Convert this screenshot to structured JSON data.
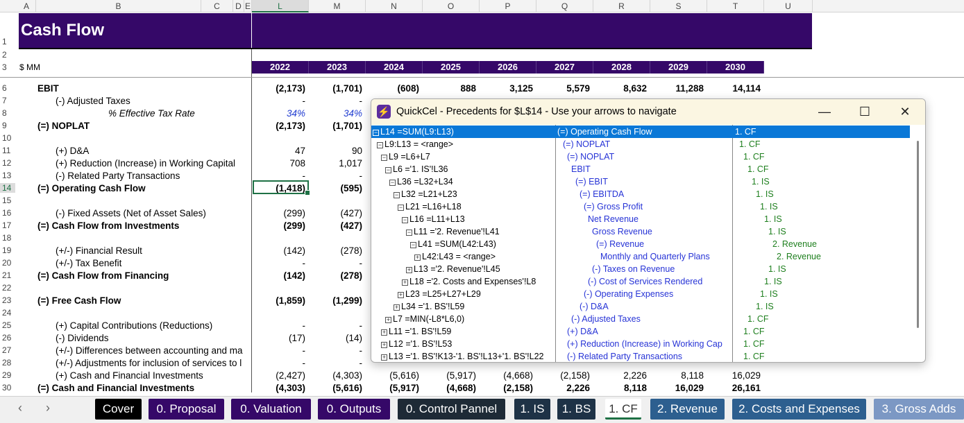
{
  "columns": [
    "A",
    "B",
    "C",
    "D",
    "E",
    "L",
    "M",
    "N",
    "O",
    "P",
    "Q",
    "R",
    "S",
    "T",
    "U"
  ],
  "row_numbers": [
    "1",
    "2",
    "3",
    "6",
    "7",
    "8",
    "9",
    "10",
    "11",
    "12",
    "13",
    "14",
    "15",
    "16",
    "17",
    "18",
    "19",
    "20",
    "21",
    "22",
    "23",
    "24",
    "25",
    "26",
    "27",
    "28",
    "29",
    "30"
  ],
  "sheet": {
    "title": "Cash Flow",
    "units": "$ MM",
    "years": [
      "2022",
      "2023",
      "2024",
      "2025",
      "2026",
      "2027",
      "2028",
      "2029",
      "2030"
    ],
    "rows": [
      {
        "label": "EBIT",
        "values": [
          "(2,173)",
          "(1,701)",
          "(608)",
          "888",
          "3,125",
          "5,579",
          "8,632",
          "11,288",
          "14,114"
        ]
      },
      {
        "label": "(-) Adjusted Taxes",
        "values": [
          "-",
          "-"
        ]
      },
      {
        "label": "% Effective Tax Rate",
        "values": [
          "34%",
          "34%"
        ]
      },
      {
        "label": "(=) NOPLAT",
        "values": [
          "(2,173)",
          "(1,701)"
        ]
      },
      {
        "label": "(+) D&A",
        "values": [
          "47",
          "90"
        ]
      },
      {
        "label": "(+) Reduction (Increase) in Working Capital",
        "values": [
          "708",
          "1,017"
        ]
      },
      {
        "label": "(-) Related Party Transactions",
        "values": [
          "-",
          "-"
        ]
      },
      {
        "label": "(=) Operating Cash Flow",
        "values": [
          "(1,418)",
          "(595)"
        ]
      },
      {
        "label": "(-) Fixed Assets (Net of Asset Sales)",
        "values": [
          "(299)",
          "(427)"
        ]
      },
      {
        "label": "(=) Cash Flow from Investments",
        "values": [
          "(299)",
          "(427)"
        ]
      },
      {
        "label": "(+/-) Financial Result",
        "values": [
          "(142)",
          "(278)"
        ]
      },
      {
        "label": "(+/-) Tax Benefit",
        "values": [
          "-",
          "-"
        ]
      },
      {
        "label": "(=) Cash Flow from Financing",
        "values": [
          "(142)",
          "(278)"
        ]
      },
      {
        "label": "(=) Free Cash Flow",
        "values": [
          "(1,859)",
          "(1,299)"
        ]
      },
      {
        "label": "(+) Capital Contributions (Reductions)",
        "values": [
          "-",
          "-"
        ]
      },
      {
        "label": "(-) Dividends",
        "values": [
          "(17)",
          "(14)"
        ]
      },
      {
        "label": "(+/-) Differences between accounting and ma",
        "values": [
          "-",
          "-"
        ]
      },
      {
        "label": "(+/-) Adjustments for inclusion of services to l",
        "values": [
          "-",
          "-"
        ]
      },
      {
        "label": "(+) Cash and Financial Investments",
        "values": [
          "(2,427)",
          "(4,303)",
          "(5,616)",
          "(5,917)",
          "(4,668)",
          "(2,158)",
          "2,226",
          "8,118",
          "16,029"
        ]
      },
      {
        "label": "(=) Cash and Financial Investments",
        "values": [
          "(4,303)",
          "(5,616)",
          "(5,917)",
          "(4,668)",
          "(2,158)",
          "2,226",
          "8,118",
          "16,029",
          "26,161"
        ]
      }
    ]
  },
  "dialog": {
    "title": "QuickCel - Precedents for $L$14 - Use your arrows to navigate",
    "minimize": "—",
    "maximize": "☐",
    "close": "✕",
    "rows": [
      {
        "formula": "L14 =SUM(L9:L13)",
        "desc": "(=) Operating Cash Flow",
        "sheet": "1. CF"
      },
      {
        "formula": "L9:L13 = <range>",
        "desc": "(=) NOPLAT",
        "sheet": "1. CF"
      },
      {
        "formula": "L9 =L6+L7",
        "desc": "(=) NOPLAT",
        "sheet": "1. CF"
      },
      {
        "formula": "L6 ='1. IS'!L36",
        "desc": "EBIT",
        "sheet": "1. CF"
      },
      {
        "formula": "L36 =L32+L34",
        "desc": "(=) EBIT",
        "sheet": "1. IS"
      },
      {
        "formula": "L32 =L21+L23",
        "desc": "(=) EBITDA",
        "sheet": "1. IS"
      },
      {
        "formula": "L21 =L16+L18",
        "desc": "(=) Gross Profit",
        "sheet": "1. IS"
      },
      {
        "formula": "L16 =L11+L13",
        "desc": "Net Revenue",
        "sheet": "1. IS"
      },
      {
        "formula": "L11 ='2. Revenue'!L41",
        "desc": "Gross Revenue",
        "sheet": "1. IS"
      },
      {
        "formula": "L41 =SUM(L42:L43)",
        "desc": "(=) Revenue",
        "sheet": "2. Revenue"
      },
      {
        "formula": "L42:L43 = <range>",
        "desc": "Monthly and Quarterly Plans",
        "sheet": "2. Revenue"
      },
      {
        "formula": "L13 ='2. Revenue'!L45",
        "desc": "(-) Taxes on Revenue",
        "sheet": "1. IS"
      },
      {
        "formula": "L18 ='2. Costs and Expenses'!L8",
        "desc": "(-) Cost of Services Rendered",
        "sheet": "1. IS"
      },
      {
        "formula": "L23 =L25+L27+L29",
        "desc": "(-) Operating Expenses",
        "sheet": "1. IS"
      },
      {
        "formula": "L34 ='1. BS'!L59",
        "desc": "(-) D&A",
        "sheet": "1. IS"
      },
      {
        "formula": "L7 =MIN(-L8*L6,0)",
        "desc": "(-) Adjusted Taxes",
        "sheet": "1. CF"
      },
      {
        "formula": "L11 ='1. BS'!L59",
        "desc": "(+) D&A",
        "sheet": "1. CF"
      },
      {
        "formula": "L12 ='1. BS'!L53",
        "desc": "(+) Reduction (Increase) in Working Cap",
        "sheet": "1. CF"
      },
      {
        "formula": "L13 ='1. BS'!K13-'1. BS'!L13+'1. BS'!L22",
        "desc": "(-) Related Party Transactions",
        "sheet": "1. CF"
      }
    ]
  },
  "tabs": [
    "Cover",
    "0. Proposal",
    "0. Valuation",
    "0. Outputs",
    "0. Control Pannel",
    "1. IS",
    "1. BS",
    "1. CF",
    "2. Revenue",
    "2. Costs and Expenses",
    "3. Gross Adds"
  ],
  "nav": {
    "prev": "‹",
    "next": "›"
  },
  "colors": {
    "banner": "#350868",
    "selection": "#0a78d7",
    "accent": "#1e7145"
  }
}
